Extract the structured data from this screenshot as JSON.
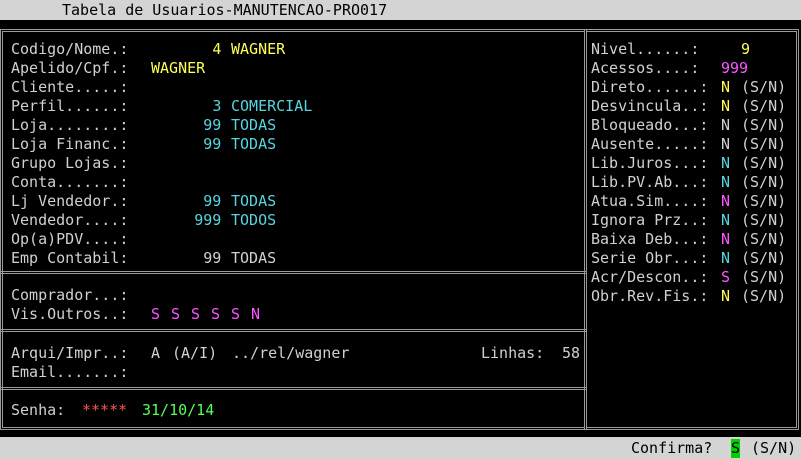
{
  "title": "Tabela de Usuarios-MANUTENCAO-PRO017",
  "left": {
    "fields": [
      {
        "label": "Codigo/Nome.:",
        "code": "4",
        "value": "WAGNER",
        "code_color": "y",
        "value_color": "y"
      },
      {
        "label": "Apelido/Cpf.:",
        "code": "",
        "value": "WAGNER",
        "code_color": "y",
        "value_color": "y"
      },
      {
        "label": "Cliente.....:",
        "code": "",
        "value": "",
        "code_color": "w",
        "value_color": "w"
      },
      {
        "label": "Perfil......:",
        "code": "3",
        "value": "COMERCIAL",
        "code_color": "c",
        "value_color": "c"
      },
      {
        "label": "Loja........:",
        "code": "99",
        "value": "TODAS",
        "code_color": "c",
        "value_color": "c"
      },
      {
        "label": "Loja Financ.:",
        "code": "99",
        "value": "TODAS",
        "code_color": "c",
        "value_color": "c"
      },
      {
        "label": "Grupo Lojas.:",
        "code": "",
        "value": "",
        "code_color": "w",
        "value_color": "w"
      },
      {
        "label": "Conta.......:",
        "code": "",
        "value": "",
        "code_color": "w",
        "value_color": "w"
      },
      {
        "label": "Lj Vendedor.:",
        "code": "99",
        "value": "TODAS",
        "code_color": "c",
        "value_color": "c"
      },
      {
        "label": "Vendedor....:",
        "code": "999",
        "value": "TODOS",
        "code_color": "c",
        "value_color": "c"
      },
      {
        "label": "Op(a)PDV....:",
        "code": "",
        "value": "",
        "code_color": "w",
        "value_color": "w"
      },
      {
        "label": "Emp Contabil:",
        "code": "99",
        "value": "TODAS",
        "code_color": "w",
        "value_color": "w"
      }
    ],
    "comprador_label": "Comprador...:",
    "vis_outros_label": "Vis.Outros..:",
    "vis_outros_flags": [
      "S",
      "S",
      "S",
      "S",
      "S",
      "N"
    ],
    "arqui_label": "Arqui/Impr..:",
    "arqui_mode": "A",
    "arqui_hint": "(A/I)",
    "arqui_path": "../rel/wagner",
    "linhas_label": "Linhas:",
    "linhas_value": "58",
    "email_label": "Email.......:",
    "senha_label": "Senha:",
    "senha_value": "*****",
    "senha_date": "31/10/14"
  },
  "right": {
    "nivel_label": "Nivel......:",
    "nivel_value": "9",
    "acessos_label": "Acessos....:",
    "acessos_value": "999",
    "flags": [
      {
        "label": "Direto......:",
        "value": "N",
        "color": "y",
        "hint": "(S/N)"
      },
      {
        "label": "Desvincula..:",
        "value": "N",
        "color": "y",
        "hint": "(S/N)"
      },
      {
        "label": "Bloqueado...:",
        "value": "N",
        "color": "w",
        "hint": "(S/N)"
      },
      {
        "label": "Ausente.....:",
        "value": "N",
        "color": "w",
        "hint": "(S/N)"
      },
      {
        "label": "Lib.Juros...:",
        "value": "N",
        "color": "c",
        "hint": "(S/N)"
      },
      {
        "label": "Lib.PV.Ab...:",
        "value": "N",
        "color": "c",
        "hint": "(S/N)"
      },
      {
        "label": "Atua.Sim....:",
        "value": "N",
        "color": "m",
        "hint": "(S/N)"
      },
      {
        "label": "Ignora Prz..:",
        "value": "N",
        "color": "c",
        "hint": "(S/N)"
      },
      {
        "label": "Baixa Deb...:",
        "value": "N",
        "color": "m",
        "hint": "(S/N)"
      },
      {
        "label": "Serie Obr...:",
        "value": "N",
        "color": "c",
        "hint": "(S/N)"
      },
      {
        "label": "Acr/Descon..:",
        "value": "S",
        "color": "m",
        "hint": "(S/N)"
      },
      {
        "label": "Obr.Rev.Fis.:",
        "value": "N",
        "color": "y",
        "hint": "(S/N)"
      }
    ]
  },
  "confirm": {
    "label": "Confirma?",
    "value": "S",
    "hint": "(S/N)"
  }
}
